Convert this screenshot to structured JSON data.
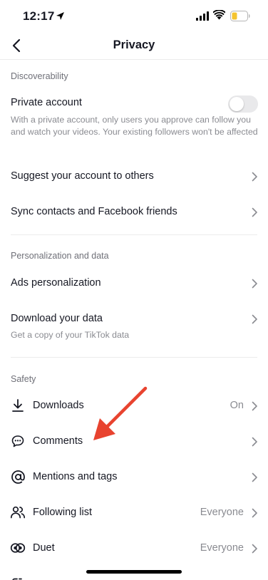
{
  "status_bar": {
    "time": "12:17"
  },
  "nav": {
    "title": "Privacy"
  },
  "sections": {
    "discoverability": "Discoverability",
    "personalization": "Personalization and data",
    "safety": "Safety"
  },
  "discoverability": {
    "private_account": {
      "label": "Private account",
      "description": "With a private account, only users you approve can follow you and watch your videos. Your existing followers won't be affected",
      "enabled": false
    },
    "suggest_account": "Suggest your account to others",
    "sync_contacts": "Sync contacts and Facebook friends"
  },
  "personalization": {
    "ads": "Ads personalization",
    "download_data": {
      "label": "Download your data",
      "description": "Get a copy of your TikTok data"
    }
  },
  "safety": {
    "downloads": {
      "label": "Downloads",
      "value": "On",
      "icon": "download-icon"
    },
    "comments": {
      "label": "Comments",
      "icon": "comment-icon"
    },
    "mentions": {
      "label": "Mentions and tags",
      "icon": "at-sign-icon"
    },
    "following": {
      "label": "Following list",
      "value": "Everyone",
      "icon": "people-icon"
    },
    "duet": {
      "label": "Duet",
      "value": "Everyone",
      "icon": "duet-icon"
    }
  },
  "colors": {
    "annotation_arrow": "#e8432f",
    "battery_fill": "#f4c430",
    "toggle_off": "#e9e9eb",
    "secondary_text": "#8a8b91"
  }
}
